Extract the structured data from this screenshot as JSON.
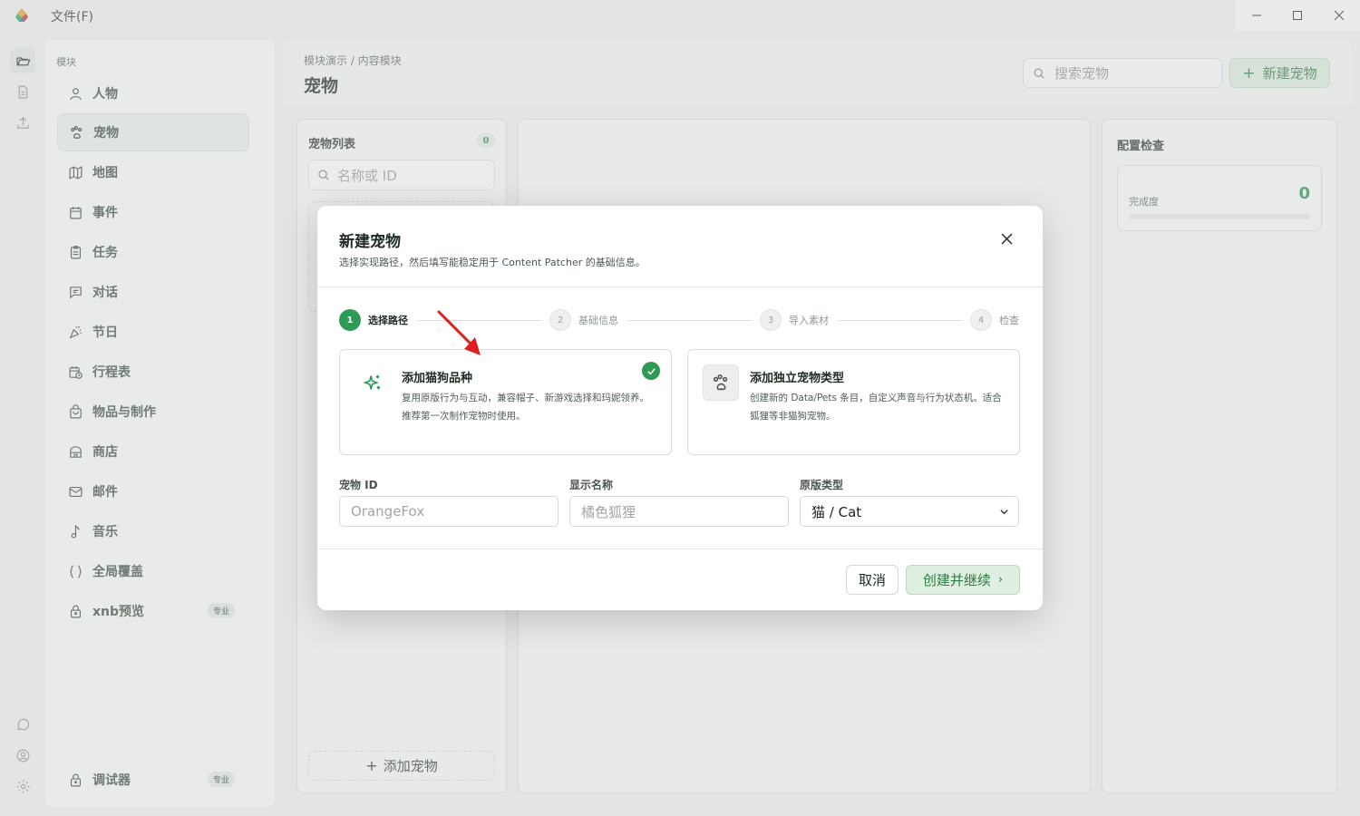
{
  "titlebar": {
    "menu_file": "文件(F)"
  },
  "sidebar": {
    "section_title": "模块",
    "items": [
      {
        "label": "人物",
        "icon": "person-icon"
      },
      {
        "label": "宠物",
        "icon": "paw-icon",
        "active": true
      },
      {
        "label": "地图",
        "icon": "map-icon"
      },
      {
        "label": "事件",
        "icon": "calendar-icon"
      },
      {
        "label": "任务",
        "icon": "clipboard-icon"
      },
      {
        "label": "对话",
        "icon": "chat-icon"
      },
      {
        "label": "节日",
        "icon": "party-icon"
      },
      {
        "label": "行程表",
        "icon": "schedule-icon"
      },
      {
        "label": "物品与制作",
        "icon": "bag-icon"
      },
      {
        "label": "商店",
        "icon": "store-icon"
      },
      {
        "label": "邮件",
        "icon": "mail-icon"
      },
      {
        "label": "音乐",
        "icon": "music-icon"
      },
      {
        "label": "全局覆盖",
        "icon": "braces-icon"
      },
      {
        "label": "xnb预览",
        "icon": "lock-icon",
        "badge": "专业"
      }
    ],
    "debugger": {
      "label": "调试器",
      "badge": "专业"
    }
  },
  "header": {
    "breadcrumb": "模块演示 / 内容模块",
    "title": "宠物",
    "search_placeholder": "搜索宠物",
    "new_button": "新建宠物"
  },
  "pet_list": {
    "title": "宠物列表",
    "count": "0",
    "search_placeholder": "名称或 ID",
    "add_button": "添加宠物"
  },
  "config_check": {
    "title": "配置检查",
    "progress_label": "完成度",
    "progress_value": "0"
  },
  "modal": {
    "title": "新建宠物",
    "subtitle": "选择实现路径，然后填写能稳定用于 Content Patcher 的基础信息。",
    "steps": [
      {
        "num": "1",
        "label": "选择路径"
      },
      {
        "num": "2",
        "label": "基础信息"
      },
      {
        "num": "3",
        "label": "导入素材"
      },
      {
        "num": "4",
        "label": "检查"
      }
    ],
    "options": [
      {
        "title": "添加猫狗品种",
        "desc": "复用原版行为与互动，兼容帽子、新游戏选择和玛妮领养。推荐第一次制作宠物时使用。",
        "selected": true
      },
      {
        "title": "添加独立宠物类型",
        "desc": "创建新的 Data/Pets 条目，自定义声音与行为状态机。适合狐狸等非猫狗宠物。",
        "selected": false
      }
    ],
    "fields": {
      "pet_id_label": "宠物 ID",
      "pet_id_placeholder": "OrangeFox",
      "display_name_label": "显示名称",
      "display_name_placeholder": "橘色狐狸",
      "base_type_label": "原版类型",
      "base_type_value": "猫 / Cat"
    },
    "cancel": "取消",
    "create": "创建并继续"
  },
  "colors": {
    "accent": "#2f9956",
    "annotation_arrow": "#e02020"
  }
}
